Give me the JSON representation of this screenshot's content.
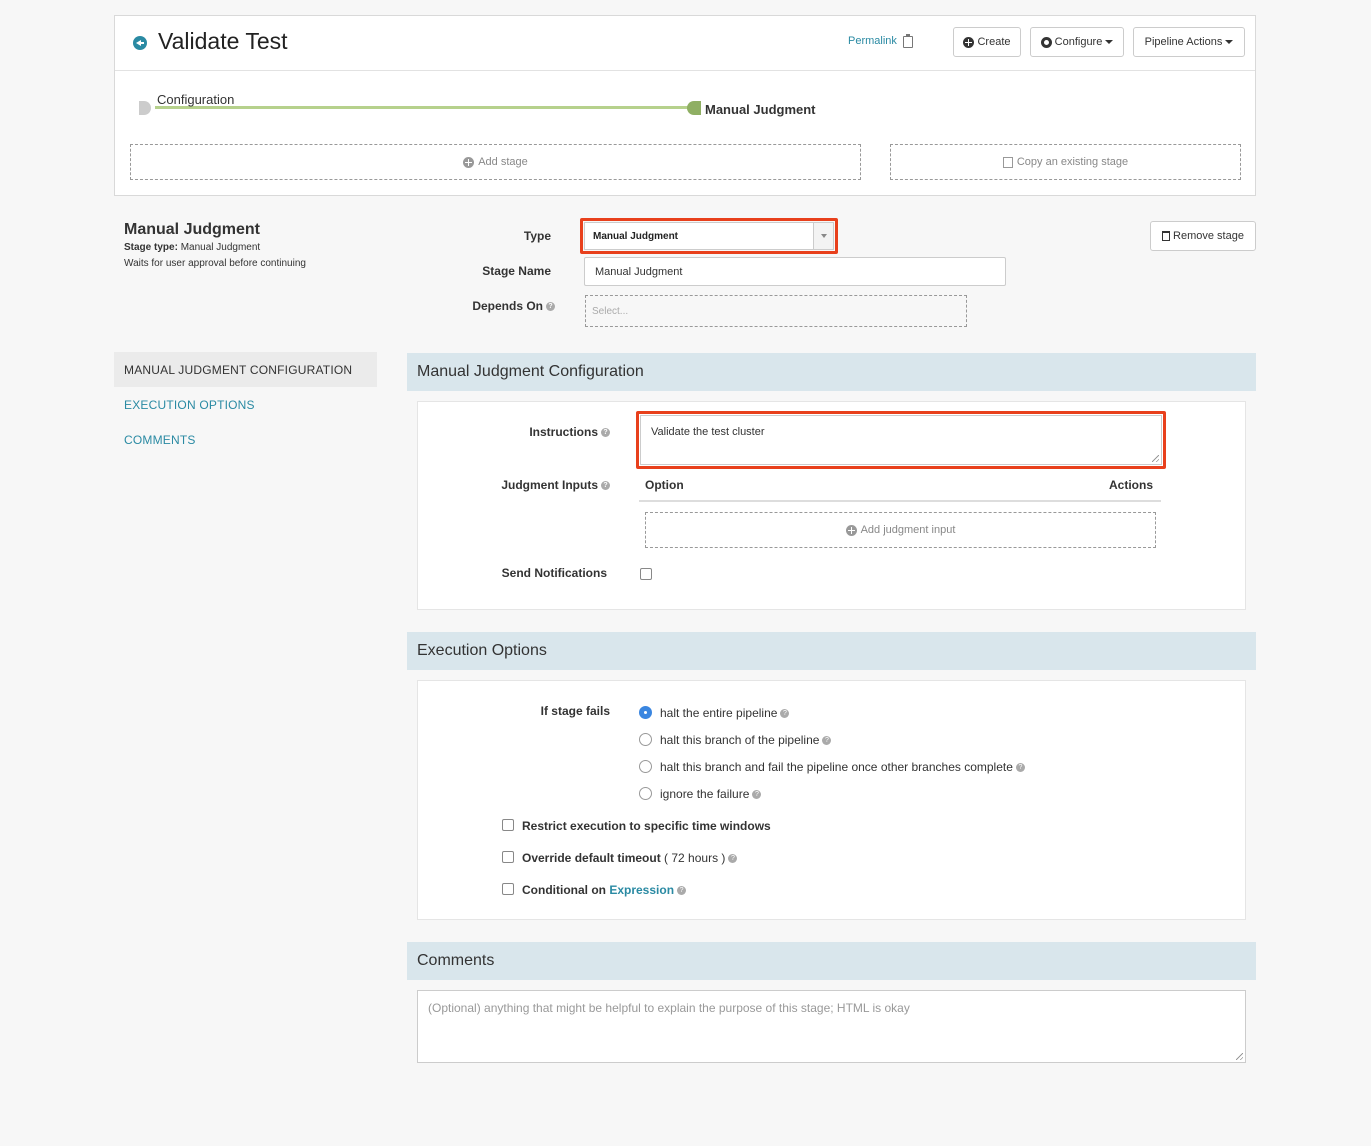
{
  "header": {
    "title": "Validate Test",
    "permalink_label": "Permalink",
    "create_label": "Create",
    "configure_label": "Configure",
    "pipeline_actions_label": "Pipeline Actions"
  },
  "graph": {
    "nodes": [
      "Configuration",
      "Manual Judgment"
    ],
    "add_stage_label": "Add stage",
    "copy_stage_label": "Copy an existing stage"
  },
  "stage": {
    "title": "Manual Judgment",
    "type_label": "Stage type:",
    "type_value": "Manual Judgment",
    "description": "Waits for user approval before continuing",
    "remove_label": "Remove stage"
  },
  "form": {
    "type_label": "Type",
    "type_value": "Manual Judgment",
    "stage_name_label": "Stage Name",
    "stage_name_value": "Manual Judgment",
    "depends_on_label": "Depends On",
    "depends_on_placeholder": "Select..."
  },
  "nav": [
    {
      "label": "MANUAL JUDGMENT CONFIGURATION"
    },
    {
      "label": "EXECUTION OPTIONS"
    },
    {
      "label": "COMMENTS"
    }
  ],
  "manual_judgment": {
    "heading": "Manual Judgment Configuration",
    "instructions_label": "Instructions",
    "instructions_value": "Validate the test cluster",
    "judgment_inputs_label": "Judgment Inputs",
    "col_option": "Option",
    "col_actions": "Actions",
    "add_input_label": "Add judgment input",
    "send_notifications_label": "Send Notifications"
  },
  "execution": {
    "heading": "Execution Options",
    "if_fails_label": "If stage fails",
    "options": [
      {
        "label": "halt the entire pipeline",
        "selected": true
      },
      {
        "label": "halt this branch of the pipeline",
        "selected": false
      },
      {
        "label": "halt this branch and fail the pipeline once other branches complete",
        "selected": false
      },
      {
        "label": "ignore the failure",
        "selected": false
      }
    ],
    "restrict_label": "Restrict execution to specific time windows",
    "override_label": "Override default timeout",
    "override_suffix": "( 72 hours )",
    "conditional_label": "Conditional on",
    "conditional_link": "Expression"
  },
  "comments": {
    "heading": "Comments",
    "placeholder": "(Optional) anything that might be helpful to explain the purpose of this stage; HTML is okay"
  },
  "colors": {
    "accent": "#2a8aa3",
    "highlight": "#e8401c",
    "section_bg": "#d9e6ec",
    "graph_line": "#b6d18c"
  }
}
